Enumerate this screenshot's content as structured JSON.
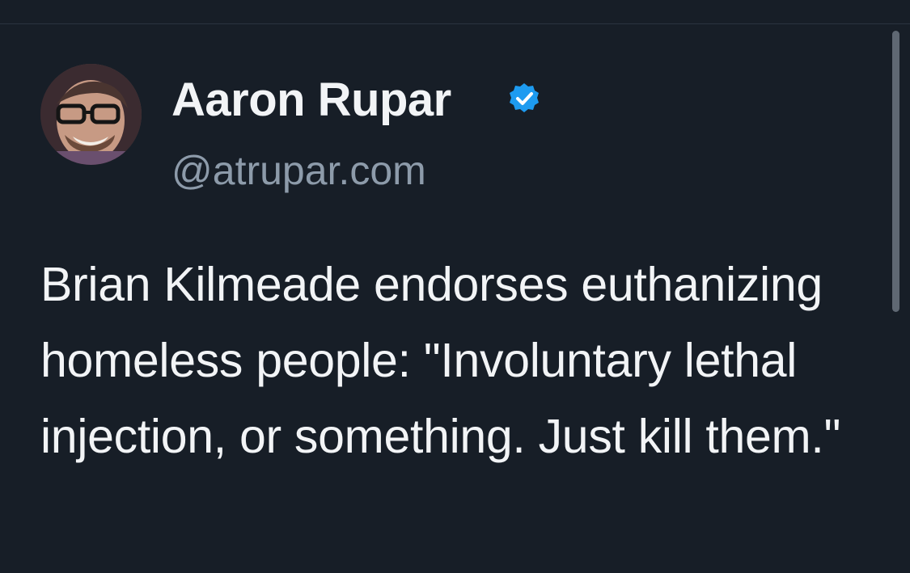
{
  "tweet": {
    "author": {
      "display_name": "Aaron Rupar",
      "handle": "@atrupar.com",
      "verified_icon": "verified-badge-icon",
      "avatar_icon": "avatar-photo"
    },
    "text": "Brian Kilmeade endorses euthanizing homeless people: \"Involuntary lethal injection, or something. Just kill them.\""
  },
  "colors": {
    "background": "#171e27",
    "text_primary": "#f2f4f6",
    "text_secondary": "#8d9baa",
    "verified_blue": "#1d9bf0",
    "scrollbar": "#5f6873"
  }
}
